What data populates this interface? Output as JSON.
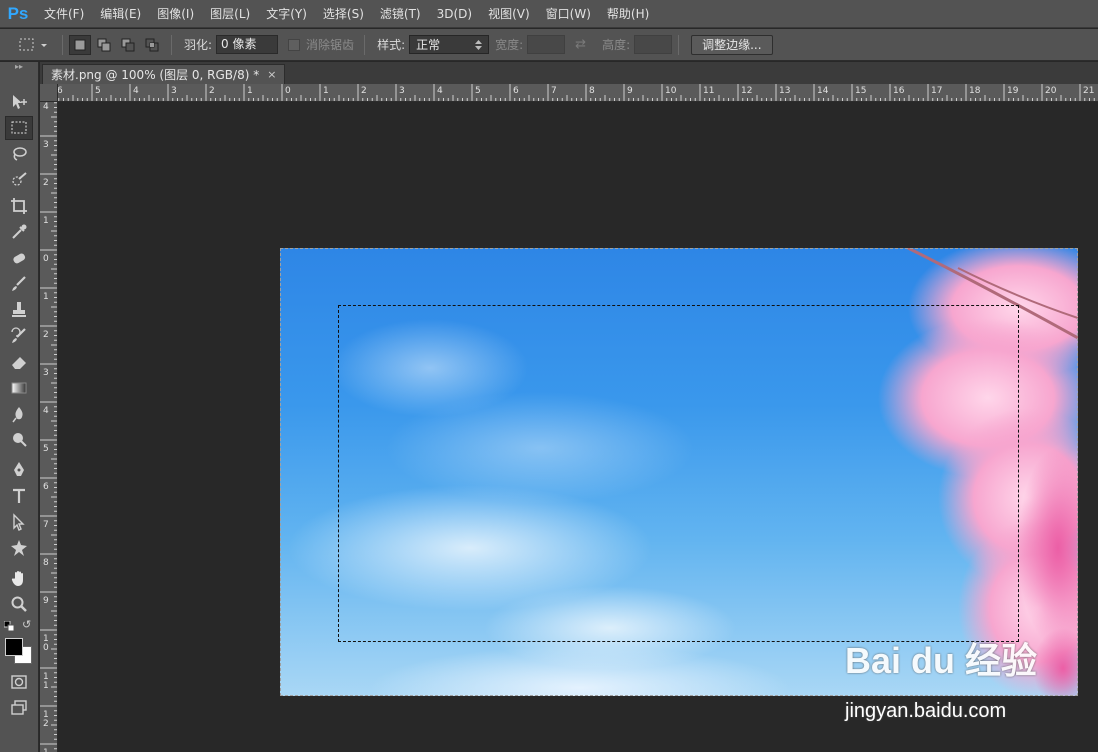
{
  "app": {
    "logo": "Ps"
  },
  "menu": [
    "文件(F)",
    "编辑(E)",
    "图像(I)",
    "图层(L)",
    "文字(Y)",
    "选择(S)",
    "滤镜(T)",
    "3D(D)",
    "视图(V)",
    "窗口(W)",
    "帮助(H)"
  ],
  "options": {
    "feather_label": "羽化:",
    "feather_value": "0 像素",
    "antialias_label": "消除锯齿",
    "style_label": "样式:",
    "style_value": "正常",
    "width_label": "宽度:",
    "height_label": "高度:",
    "refine_label": "调整边缘..."
  },
  "document": {
    "tab_title": "素材.png @ 100% (图层 0, RGB/8) *",
    "close_glyph": "×"
  },
  "rulers": {
    "h_labels": [
      "6",
      "5",
      "4",
      "3",
      "2",
      "1",
      "0",
      "1",
      "2",
      "3",
      "4",
      "5",
      "6",
      "7",
      "8",
      "9",
      "10",
      "11",
      "12",
      "13",
      "14",
      "15",
      "16",
      "17",
      "18",
      "19",
      "20",
      "21"
    ],
    "v_labels": [
      "4",
      "3",
      "2",
      "1",
      "0",
      "1",
      "2",
      "3",
      "4",
      "5",
      "6",
      "7",
      "8",
      "9",
      "10",
      "11",
      "12",
      "13"
    ]
  },
  "tools": [
    "move-icon",
    "rect-marquee-icon",
    "lasso-icon",
    "quick-select-icon",
    "crop-icon",
    "eyedropper-icon",
    "spot-heal-icon",
    "brush-icon",
    "clone-stamp-icon",
    "history-brush-icon",
    "eraser-icon",
    "gradient-icon",
    "blur-icon",
    "dodge-icon",
    "pen-icon",
    "type-icon",
    "path-select-icon",
    "custom-shape-icon",
    "hand-icon",
    "zoom-icon"
  ],
  "colors": {
    "foreground": "#000000",
    "background": "#ffffff",
    "accent": "#31a8ff"
  },
  "watermark": {
    "logo": "Bai du 经验",
    "url": "jingyan.baidu.com"
  }
}
